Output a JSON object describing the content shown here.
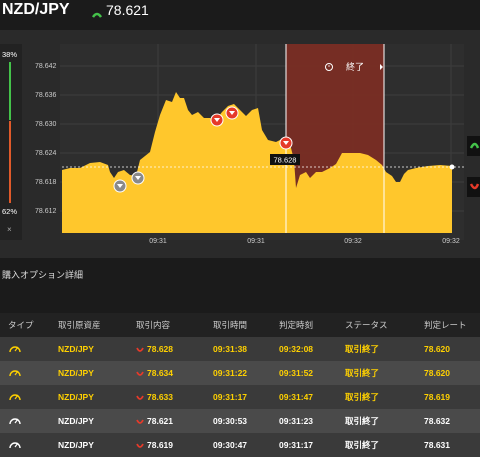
{
  "header": {
    "pair": "NZD/JPY",
    "price": "78.621"
  },
  "ratio": {
    "up": "38%",
    "down": "62%",
    "close": "×"
  },
  "chart": {
    "y_ticks": [
      "78.642",
      "78.636",
      "78.630",
      "78.624",
      "78.618",
      "78.612"
    ],
    "x_ticks": [
      "09:31",
      "09:31",
      "09:32",
      "09:32"
    ],
    "ended_label": "終了",
    "current_label": "78.628"
  },
  "section": {
    "title": "購入オプション詳細"
  },
  "table": {
    "headers": [
      "タイプ",
      "取引原資産",
      "取引内容",
      "取引時間",
      "判定時刻",
      "ステータス",
      "判定レート"
    ],
    "rows": [
      {
        "asset": "NZD/JPY",
        "content": "78.628",
        "time": "09:31:38",
        "judge": "09:32:08",
        "status": "取引終了",
        "rate": "78.620"
      },
      {
        "asset": "NZD/JPY",
        "content": "78.634",
        "time": "09:31:22",
        "judge": "09:31:52",
        "status": "取引終了",
        "rate": "78.620"
      },
      {
        "asset": "NZD/JPY",
        "content": "78.633",
        "time": "09:31:17",
        "judge": "09:31:47",
        "status": "取引終了",
        "rate": "78.619"
      },
      {
        "asset": "NZD/JPY",
        "content": "78.621",
        "time": "09:30:53",
        "judge": "09:31:23",
        "status": "取引終了",
        "rate": "78.632"
      },
      {
        "asset": "NZD/JPY",
        "content": "78.619",
        "time": "09:30:47",
        "judge": "09:31:17",
        "status": "取引終了",
        "rate": "78.631"
      }
    ]
  },
  "colors": {
    "area_fill": "#ffc72c",
    "ended_zone": "#7a2d24",
    "up": "#44c24a",
    "down": "#e53a2a",
    "active_text": "#ffd100"
  }
}
